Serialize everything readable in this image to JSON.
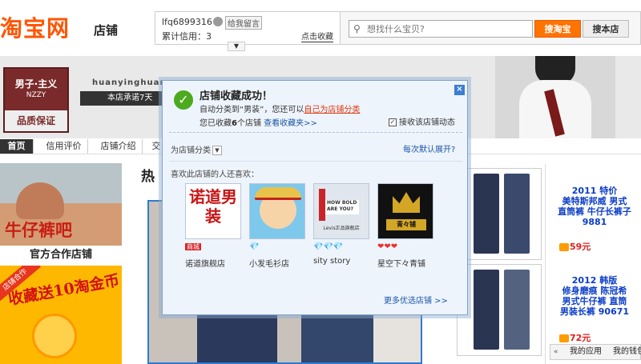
{
  "header": {
    "logo_text": "淘宝网",
    "logo_sub": "店铺",
    "username": "lfq6899316",
    "message_button": "给我留言",
    "credit_text": "累计信用：3",
    "favorite_button": "点击收藏",
    "search_placeholder": "想找什么宝贝?",
    "search_taobao_button": "搜淘宝",
    "search_shop_button": "搜本店"
  },
  "banner": {
    "brand_line1": "男子·主义",
    "brand_line2": "NZZY",
    "brand_line3": "品质保证",
    "shop_name": "huanyinghuang",
    "promise": "本店承诺7天"
  },
  "nav": {
    "items": [
      {
        "label": "首页"
      },
      {
        "label": "信用评价"
      },
      {
        "label": "店铺介绍"
      },
      {
        "label": "交"
      }
    ]
  },
  "left": {
    "promo1_title": "牛仔裤吧",
    "promo1_caption": "官方合作店铺",
    "promo2_ribbon": "店铺合作",
    "promo2_title": "收藏送10淘金币"
  },
  "middle": {
    "hot_title": "热"
  },
  "products": [
    {
      "title_lines": [
        "2011 特价",
        "美特斯邦威 男式",
        "直筒裤 牛仔长裤子",
        "9881"
      ],
      "price": "59元"
    },
    {
      "title_lines": [
        "2012 韩版",
        "修身磨痕 陈冠希",
        "男式牛仔裤 直筒",
        "男装长裤 90671"
      ],
      "price": "72元"
    }
  ],
  "bottom_bar": {
    "arrows": "«",
    "app_label": "我的应用",
    "wallet_label": "我的钱包"
  },
  "popup": {
    "title": "店铺收藏成功！",
    "line1_prefix": "自动分类到“男装”，您还可以",
    "line1_link": "自己为店铺分类",
    "line2_prefix": "您已收藏",
    "line2_count": "6",
    "line2_suffix": "个店铺",
    "view_favorites_link": "查看收藏夹>>",
    "checkbox_label": "接收该店铺动态",
    "checkbox_checked": true,
    "categorize_label": "为店铺分类",
    "expand_default_link": "每次默认展开?",
    "also_like_label": "喜欢此店铺的人还喜欢：",
    "shops": [
      {
        "thumb_text": "诺道男装",
        "rank_type": "商城",
        "rank_icons": "",
        "name": "诺道旗舰店"
      },
      {
        "thumb_text": "",
        "rank_type": "",
        "rank_icons": "💎",
        "name": "小发毛衫店"
      },
      {
        "thumb_text": "HOW BOLD ARE YOU?",
        "thumb_sub": "Levis正品旗舰店",
        "rank_type": "",
        "rank_icons": "💎💎💎",
        "name": "sity story"
      },
      {
        "thumb_text": "青々铺",
        "rank_type": "",
        "rank_icons": "❤❤❤",
        "name": "星空下々青铺"
      }
    ],
    "more_shops_link": "更多优选店铺 >>"
  }
}
